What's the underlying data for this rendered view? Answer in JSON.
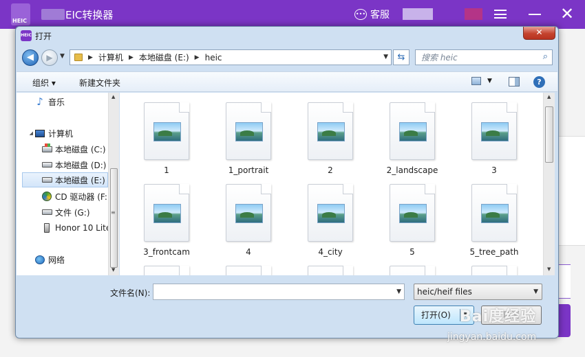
{
  "app": {
    "title": "EIC转换器",
    "logo_text": "HEIC",
    "service_label": "客服"
  },
  "dialog": {
    "icon_text": "HEIC",
    "title": "打开",
    "close_symbol": "✕",
    "address": {
      "path": [
        "计算机",
        "本地磁盘 (E:)",
        "heic"
      ]
    },
    "search": {
      "placeholder": "搜索 heic"
    },
    "toolbar": {
      "organize_label": "组织 ▾",
      "new_folder_label": "新建文件夹"
    },
    "nav": {
      "items": [
        {
          "label": "音乐",
          "icon": "music-icon"
        },
        {
          "label": "计算机",
          "icon": "computer-icon"
        },
        {
          "label": "本地磁盘 (C:)",
          "icon": "drive-c-icon"
        },
        {
          "label": "本地磁盘 (D:)",
          "icon": "drive-icon"
        },
        {
          "label": "本地磁盘 (E:)",
          "icon": "drive-icon",
          "selected": true
        },
        {
          "label": "CD 驱动器 (F:",
          "icon": "cd-drive-icon"
        },
        {
          "label": "文件 (G:)",
          "icon": "drive-icon"
        },
        {
          "label": "Honor 10 Lite",
          "icon": "phone-icon"
        },
        {
          "label": "网络",
          "icon": "network-icon"
        }
      ]
    },
    "files": [
      {
        "name": "1"
      },
      {
        "name": "1_portrait"
      },
      {
        "name": "2"
      },
      {
        "name": "2_landscape"
      },
      {
        "name": "3"
      },
      {
        "name": "3_frontcam"
      },
      {
        "name": "4"
      },
      {
        "name": "4_city"
      },
      {
        "name": "5"
      },
      {
        "name": "5_tree_path"
      }
    ],
    "filename": {
      "label": "文件名(N):",
      "value": ""
    },
    "filetype": {
      "selected": "heic/heif files"
    },
    "buttons": {
      "open_label": "打开(O)",
      "cancel_label": "取消"
    }
  },
  "watermark": {
    "line1": "Bai度经验",
    "line2": "jingyan.baidu.com"
  },
  "colors": {
    "app_purple": "#7b35c6",
    "dialog_frame": "#cfe0f2"
  }
}
